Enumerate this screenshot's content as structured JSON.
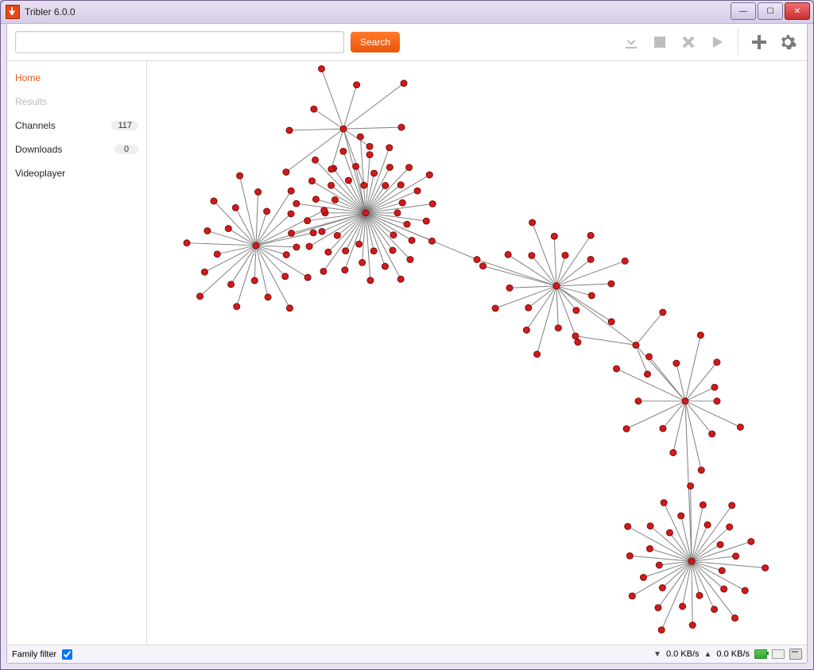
{
  "window": {
    "title": "Tribler 6.0.0"
  },
  "toolbar": {
    "search_placeholder": "",
    "search_button": "Search",
    "icons": {
      "download": "download-icon",
      "stop": "stop-icon",
      "delete": "delete-icon",
      "play": "play-icon",
      "add": "add-icon",
      "settings": "settings-gear-icon"
    }
  },
  "sidebar": {
    "items": [
      {
        "label": "Home",
        "active": true
      },
      {
        "label": "Results",
        "disabled": true
      },
      {
        "label": "Channels",
        "badge": "117"
      },
      {
        "label": "Downloads",
        "badge": "0"
      },
      {
        "label": "Videoplayer"
      }
    ]
  },
  "statusbar": {
    "family_filter_label": "Family filter",
    "family_filter_checked": true,
    "down_speed": "0.0 KB/s",
    "up_speed": "0.0 KB/s"
  },
  "chart_data": {
    "type": "network-graph",
    "title": "",
    "node_count_estimate": 150,
    "hubs": [
      {
        "id": "A",
        "pos": [
          460,
          270
        ],
        "leaves": 46
      },
      {
        "id": "B",
        "pos": [
          322,
          312
        ],
        "leaves": 24
      },
      {
        "id": "C",
        "pos": [
          432,
          162
        ],
        "leaves": 10
      },
      {
        "id": "D",
        "pos": [
          700,
          364
        ],
        "leaves": 20
      },
      {
        "id": "E",
        "pos": [
          800,
          440
        ],
        "leaves": 3
      },
      {
        "id": "F",
        "pos": [
          862,
          512
        ],
        "leaves": 14
      },
      {
        "id": "G",
        "pos": [
          870,
          718
        ],
        "leaves": 30
      }
    ],
    "links": [
      [
        "A",
        "B"
      ],
      [
        "A",
        "C"
      ],
      [
        "A",
        "bridge1"
      ],
      [
        "bridge1",
        "D"
      ],
      [
        "D",
        "E"
      ],
      [
        "E",
        "F"
      ],
      [
        "F",
        "G"
      ]
    ],
    "bridge_nodes": {
      "bridge1": [
        600,
        330
      ]
    }
  }
}
